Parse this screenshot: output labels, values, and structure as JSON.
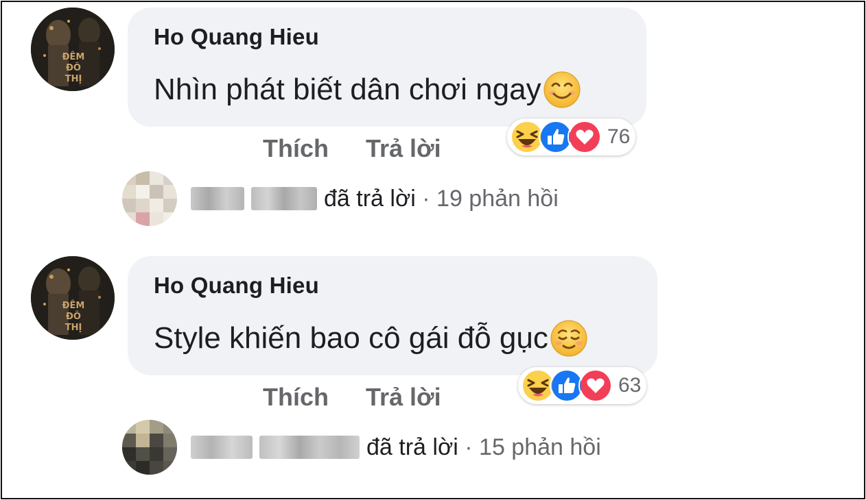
{
  "comments": [
    {
      "author": "Ho Quang Hieu",
      "text": "Nhìn phát biết dân chơi ngay",
      "emoji": "smiling-face-icon",
      "actions": {
        "like": "Thích",
        "reply": "Trả lời"
      },
      "reactions": {
        "icons": [
          "haha-icon",
          "like-icon",
          "love-icon"
        ],
        "count": "76"
      },
      "reply_summary": {
        "verb": "đã trả lời",
        "separator": "·",
        "count_text": "19 phản hồi"
      }
    },
    {
      "author": "Ho Quang Hieu",
      "text": "Style khiến bao cô gái đỗ gục",
      "emoji": "relieved-face-icon",
      "actions": {
        "like": "Thích",
        "reply": "Trả lời"
      },
      "reactions": {
        "icons": [
          "haha-icon",
          "like-icon",
          "love-icon"
        ],
        "count": "63"
      },
      "reply_summary": {
        "verb": "đã trả lời",
        "separator": "·",
        "count_text": "15 phản hồi"
      }
    }
  ],
  "avatar_caption": [
    "ĐÊM",
    "ĐÔ",
    "THỊ"
  ],
  "colors": {
    "bubble": "#f0f2f5",
    "text": "#1c1e21",
    "muted": "#65676b",
    "like_blue": "#1877f2",
    "love_red": "#f33e58",
    "haha_yellow": "#fbd04b"
  }
}
